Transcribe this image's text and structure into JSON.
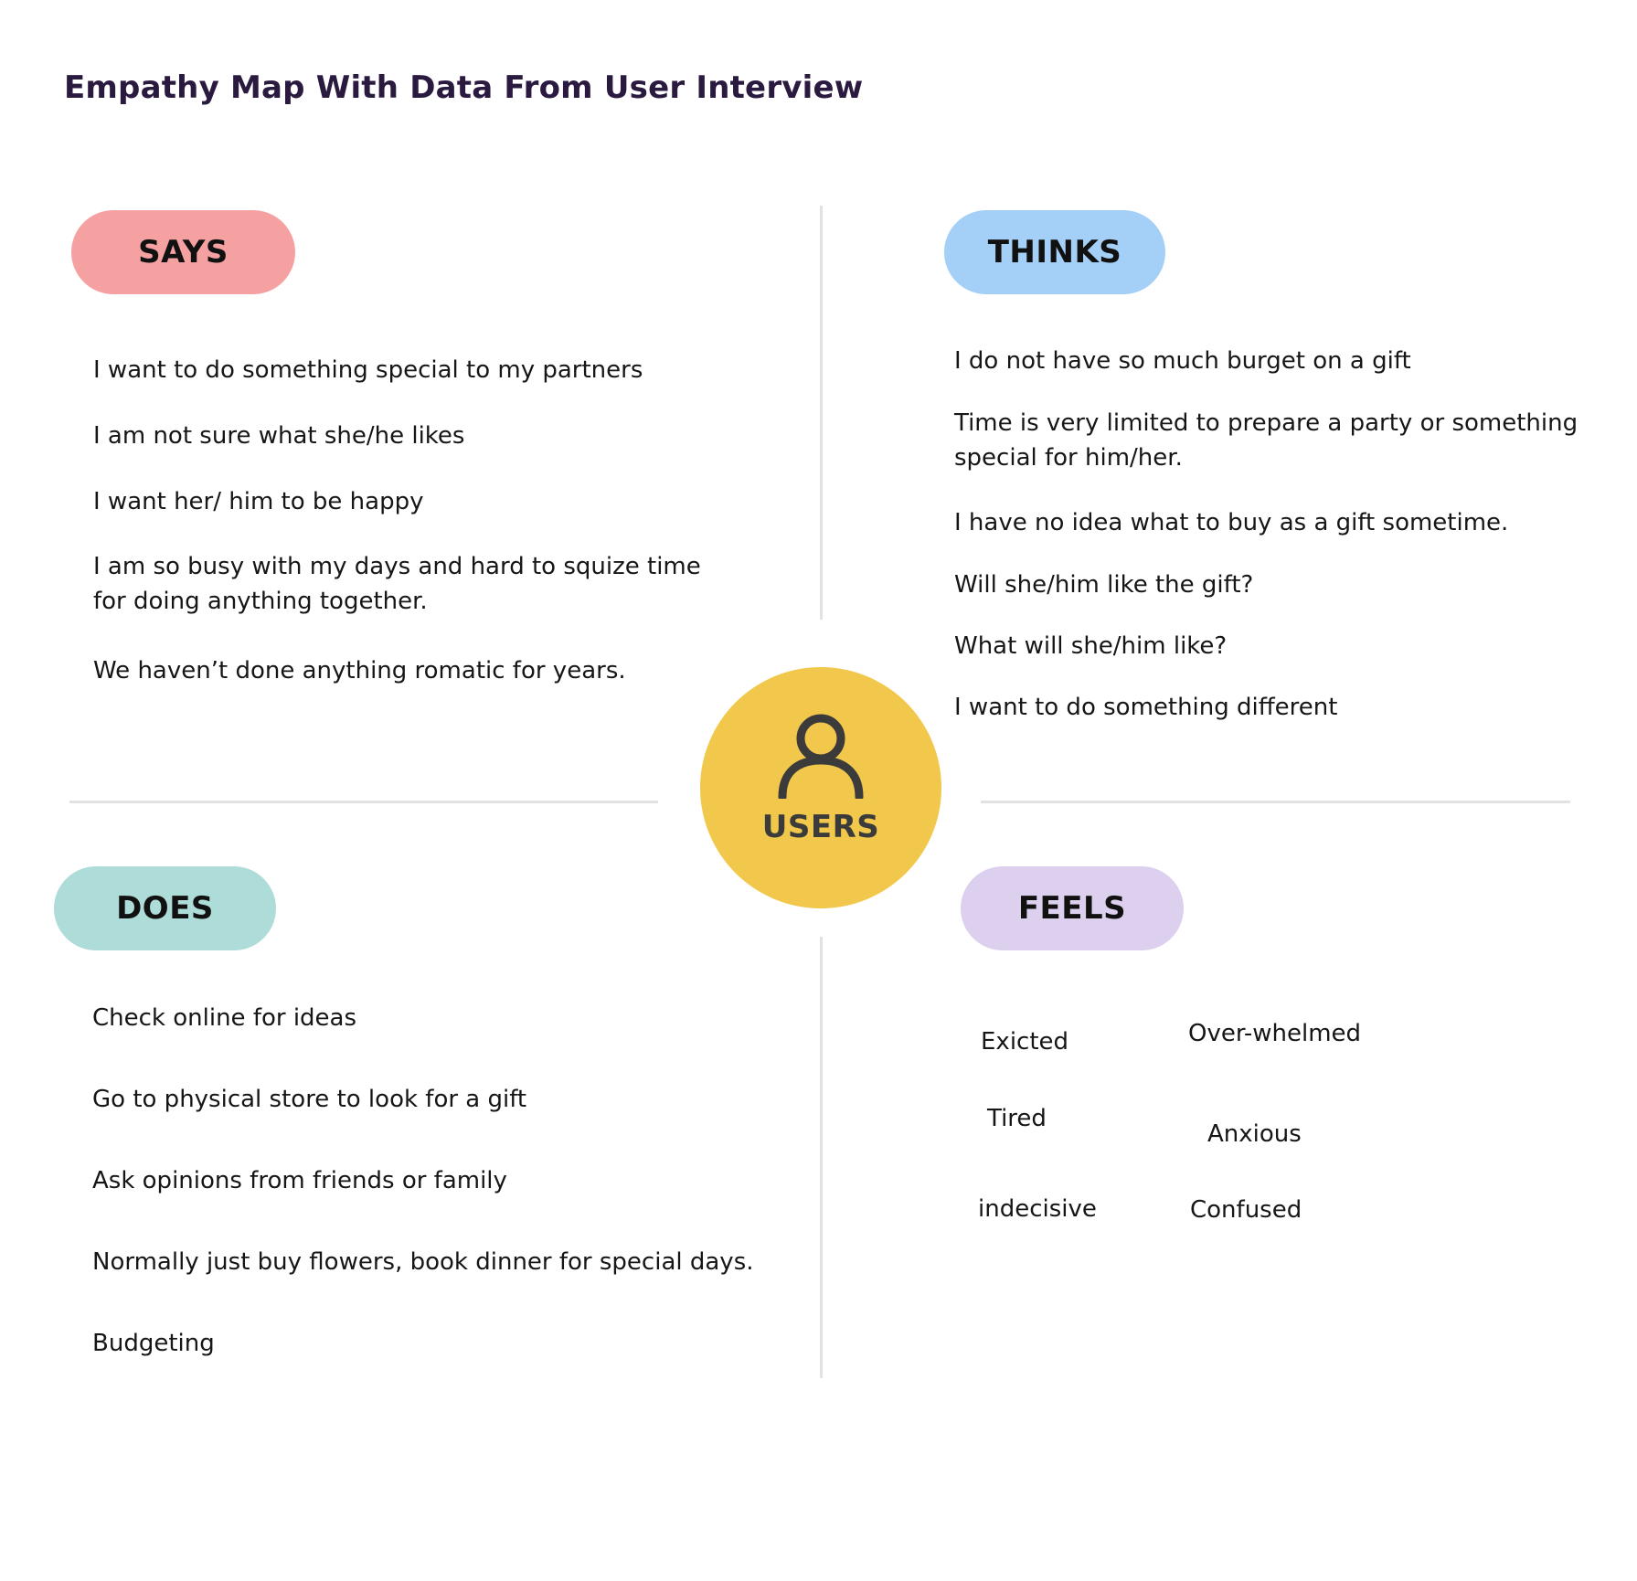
{
  "title": "Empathy Map With Data From User Interview",
  "center": {
    "label": "USERS",
    "icon": "user-icon",
    "color": "#f2c84c"
  },
  "says": {
    "label": "SAYS",
    "color": "#f6a1a1",
    "items": [
      "I want to do something special to my partners",
      "I am not sure what she/he likes",
      "I want her/ him to be happy",
      "I am so busy with my days and hard to squize time",
      "for doing anything together.",
      "We haven’t done anything romatic for years."
    ]
  },
  "thinks": {
    "label": "THINKS",
    "color": "#a4cff7",
    "items": [
      "I do not have so much burget on a gift",
      "Time is very limited to prepare a party or something",
      "special for him/her.",
      "I have no idea what to buy as a gift sometime.",
      "Will she/him like the gift?",
      "What will she/him like?",
      "I want to do something different"
    ]
  },
  "does": {
    "label": "DOES",
    "color": "#addcd9",
    "items": [
      "Check online for ideas",
      "Go to physical store  to look for a gift",
      "Ask opinions from friends or family",
      "Normally just buy flowers, book dinner for special days.",
      "Budgeting"
    ]
  },
  "feels": {
    "label": "FEELS",
    "color": "#dcd0ee",
    "items": [
      "Exicted",
      "Over-whelmed",
      "Tired",
      "Anxious",
      "indecisive",
      "Confused"
    ]
  }
}
